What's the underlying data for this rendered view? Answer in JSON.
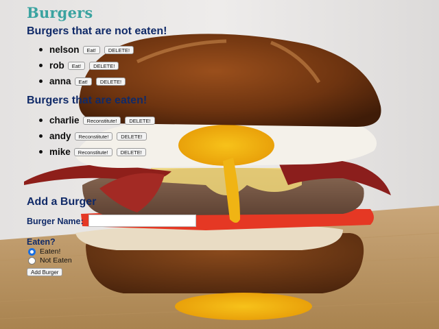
{
  "title": "Burgers",
  "not_eaten": {
    "heading": "Burgers that are not eaten!",
    "items": [
      {
        "name": "nelson",
        "eat_label": "Eat!",
        "delete_label": "DELETE!"
      },
      {
        "name": "rob",
        "eat_label": "Eat!",
        "delete_label": "DELETE!"
      },
      {
        "name": "anna",
        "eat_label": "Eat!",
        "delete_label": "DELETE!"
      }
    ]
  },
  "eaten": {
    "heading": "Burgers that are eaten!",
    "items": [
      {
        "name": "charlie",
        "reconstitute_label": "Reconstitute!",
        "delete_label": "DELETE!"
      },
      {
        "name": "andy",
        "reconstitute_label": "Reconstitute!",
        "delete_label": "DELETE!"
      },
      {
        "name": "mike",
        "reconstitute_label": "Reconstitute!",
        "delete_label": "DELETE!"
      }
    ]
  },
  "form": {
    "heading": "Add a Burger",
    "name_label": "Burger Name:",
    "name_value": "",
    "eaten_label": "Eaten?",
    "options": [
      {
        "label": "Eaten!",
        "checked": true
      },
      {
        "label": "Not Eaten",
        "checked": false
      }
    ],
    "submit_label": "Add Burger"
  },
  "colors": {
    "title": "#3aa3a0",
    "heading": "#102a68",
    "radio_selected": "#1a6fe0"
  }
}
